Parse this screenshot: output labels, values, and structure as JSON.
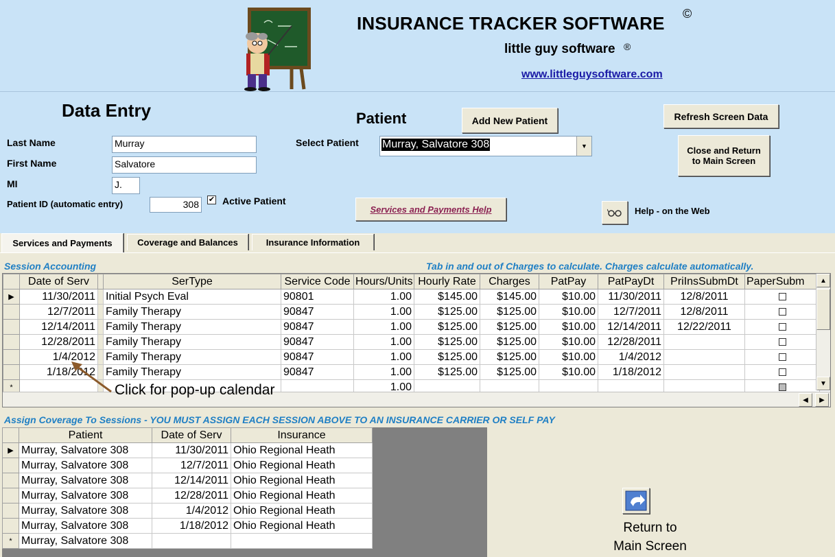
{
  "header": {
    "title": "INSURANCE TRACKER SOFTWARE",
    "copyright_symbol": "©",
    "company": "little guy software",
    "registered_symbol": "®",
    "website": "www.littleguysoftware.com"
  },
  "form": {
    "heading": "Data Entry",
    "last_name_label": "Last Name",
    "last_name_value": "Murray",
    "first_name_label": "First Name",
    "first_name_value": "Salvatore",
    "mi_label": "MI",
    "mi_value": "J.",
    "patient_id_label": "Patient  ID (automatic entry)",
    "patient_id_value": "308",
    "active_patient_label": "Active Patient",
    "active_patient_checked": true
  },
  "patient": {
    "heading": "Patient",
    "add_new_label": "Add New Patient",
    "select_label": "Select Patient",
    "select_value": "Murray, Salvatore 308",
    "help_link_label": "Services and Payments Help"
  },
  "right_buttons": {
    "refresh_label": "Refresh Screen Data",
    "close_line1": "Close and Return",
    "close_line2": "to Main Screen",
    "web_help_label": "Help - on the Web"
  },
  "tabs": [
    {
      "label": "Services and Payments",
      "active": true
    },
    {
      "label": "Coverage and Balances",
      "active": false
    },
    {
      "label": "Insurance Information",
      "active": false
    }
  ],
  "session_accounting": {
    "title": "Session Accounting",
    "hint": "Tab in and out of Charges to calculate. Charges calculate automatically.",
    "columns": [
      "Date of Serv",
      "SerType",
      "Service Code",
      "Hours/Units",
      "Hourly Rate",
      "Charges",
      "PatPay",
      "PatPayDt",
      "PriInsSubmDt",
      "PaperSubm"
    ],
    "rows": [
      {
        "date": "11/30/2011",
        "sertype": "Initial Psych Eval",
        "code": "90801",
        "hours": "1.00",
        "rate": "$145.00",
        "charges": "$145.00",
        "patpay": "$10.00",
        "patpaydt": "11/30/2011",
        "submdt": "12/8/2011"
      },
      {
        "date": "12/7/2011",
        "sertype": "Family Therapy",
        "code": "90847",
        "hours": "1.00",
        "rate": "$125.00",
        "charges": "$125.00",
        "patpay": "$10.00",
        "patpaydt": "12/7/2011",
        "submdt": "12/8/2011"
      },
      {
        "date": "12/14/2011",
        "sertype": "Family Therapy",
        "code": "90847",
        "hours": "1.00",
        "rate": "$125.00",
        "charges": "$125.00",
        "patpay": "$10.00",
        "patpaydt": "12/14/2011",
        "submdt": "12/22/2011"
      },
      {
        "date": "12/28/2011",
        "sertype": "Family Therapy",
        "code": "90847",
        "hours": "1.00",
        "rate": "$125.00",
        "charges": "$125.00",
        "patpay": "$10.00",
        "patpaydt": "12/28/2011",
        "submdt": ""
      },
      {
        "date": "1/4/2012",
        "sertype": "Family Therapy",
        "code": "90847",
        "hours": "1.00",
        "rate": "$125.00",
        "charges": "$125.00",
        "patpay": "$10.00",
        "patpaydt": "1/4/2012",
        "submdt": ""
      },
      {
        "date": "1/18/2012",
        "sertype": "Family Therapy",
        "code": "90847",
        "hours": "1.00",
        "rate": "$125.00",
        "charges": "$125.00",
        "patpay": "$10.00",
        "patpaydt": "1/18/2012",
        "submdt": ""
      }
    ],
    "new_row_hours": "1.00",
    "current_marker": "▶",
    "new_marker": "*",
    "annotation": "Click for pop-up calendar"
  },
  "coverage": {
    "title": "Assign Coverage To Sessions  - YOU MUST ASSIGN EACH SESSION ABOVE TO AN INSURANCE CARRIER OR SELF PAY",
    "columns": [
      "Patient",
      "Date of Serv",
      "Insurance"
    ],
    "rows": [
      {
        "patient": "Murray, Salvatore 308",
        "date": "11/30/2011",
        "insurance": "Ohio Regional Heath"
      },
      {
        "patient": "Murray, Salvatore 308",
        "date": "12/7/2011",
        "insurance": "Ohio Regional Heath"
      },
      {
        "patient": "Murray, Salvatore 308",
        "date": "12/14/2011",
        "insurance": "Ohio Regional Heath"
      },
      {
        "patient": "Murray, Salvatore 308",
        "date": "12/28/2011",
        "insurance": "Ohio Regional Heath"
      },
      {
        "patient": "Murray, Salvatore 308",
        "date": "1/4/2012",
        "insurance": "Ohio Regional Heath"
      },
      {
        "patient": "Murray, Salvatore 308",
        "date": "1/18/2012",
        "insurance": "Ohio Regional Heath"
      }
    ],
    "new_row_patient": "Murray, Salvatore 308"
  },
  "return_button": {
    "line1": "Return to",
    "line2": "Main Screen"
  },
  "colors": {
    "header_bg": "#c9e3f7",
    "panel_bg": "#ece9d8",
    "section_title": "#1f7fc4",
    "link": "#1a1aa6",
    "help_link": "#8b2252"
  },
  "icons": {
    "teacher": "teacher-chalkboard-icon",
    "glasses": "glasses-icon",
    "return": "return-arrow-icon",
    "dropdown": "chevron-down-icon"
  }
}
